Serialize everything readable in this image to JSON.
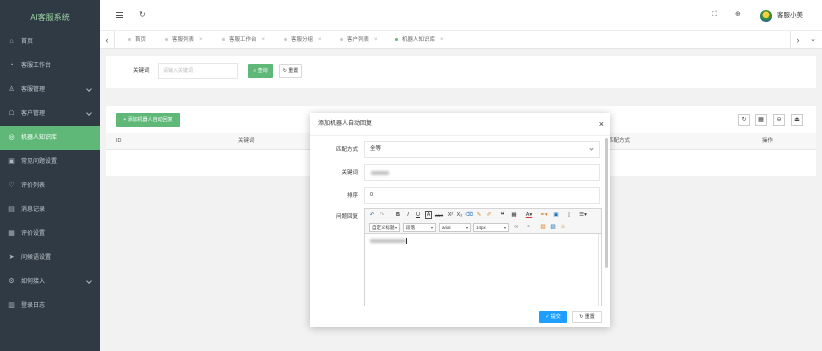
{
  "app": {
    "title": "AI客服系统"
  },
  "colors": {
    "primary": "#5fb878",
    "submit": "#1e9fff",
    "sidebar_bg": "#2f3a44"
  },
  "sidebar": {
    "items": [
      {
        "label": "首页",
        "icon": "home-icon"
      },
      {
        "label": "客服工作台",
        "icon": "workbench-icon"
      },
      {
        "label": "客服管理",
        "icon": "user-icon",
        "has_children": true
      },
      {
        "label": "客户管理",
        "icon": "customer-icon",
        "has_children": true
      },
      {
        "label": "机器人知识库",
        "icon": "robot-icon",
        "active": true
      },
      {
        "label": "常见问题设置",
        "icon": "faq-icon"
      },
      {
        "label": "评价列表",
        "icon": "rating-icon"
      },
      {
        "label": "消息记录",
        "icon": "message-icon"
      },
      {
        "label": "评价设置",
        "icon": "rating-settings-icon"
      },
      {
        "label": "问候语设置",
        "icon": "greeting-icon"
      },
      {
        "label": "如何接入",
        "icon": "access-icon",
        "has_children": true
      },
      {
        "label": "登录日志",
        "icon": "login-log-icon"
      }
    ]
  },
  "header": {
    "icons": [
      "menu-toggle-icon",
      "refresh-icon",
      "fullscreen-icon",
      "theme-icon"
    ],
    "user_name": "客服小美"
  },
  "tabs": [
    {
      "label": "首页",
      "closable": false
    },
    {
      "label": "客服列表",
      "closable": true
    },
    {
      "label": "客服工作台",
      "closable": true
    },
    {
      "label": "客服分组",
      "closable": true
    },
    {
      "label": "客户列表",
      "closable": true
    },
    {
      "label": "机器人知识库",
      "closable": true,
      "active": true
    }
  ],
  "search": {
    "keyword_label": "关键词",
    "keyword_placeholder": "请输入关键词",
    "query_label": "查询",
    "reset_label": "重置"
  },
  "table": {
    "add_button": "添加机器人自动回复",
    "toolbar_icons": [
      "refresh-icon",
      "columns-icon",
      "print-icon",
      "export-icon"
    ],
    "columns_visible": [
      "ID",
      "关键词",
      "匹配方式",
      "操作"
    ]
  },
  "modal": {
    "title": "添加机器人自动回复",
    "match_label": "匹配方式",
    "match_value": "全等",
    "keyword_label": "关键词",
    "sort_label": "排序",
    "sort_value": "0",
    "reply_label": "问题回复",
    "editor": {
      "toolbar_row1": {
        "bold": "B",
        "italic": "I",
        "underline": "U",
        "fontborder": "A",
        "strikethrough": "ABC",
        "superscript": "X²",
        "subscript": "X₂",
        "forecolor": "A"
      },
      "toolbar_row2": {
        "custom_heading": "自定义标题",
        "paragraph": "段落",
        "font_family": "arial",
        "font_size": "14px"
      }
    },
    "submit_label": "提交",
    "reset_label": "重置"
  }
}
